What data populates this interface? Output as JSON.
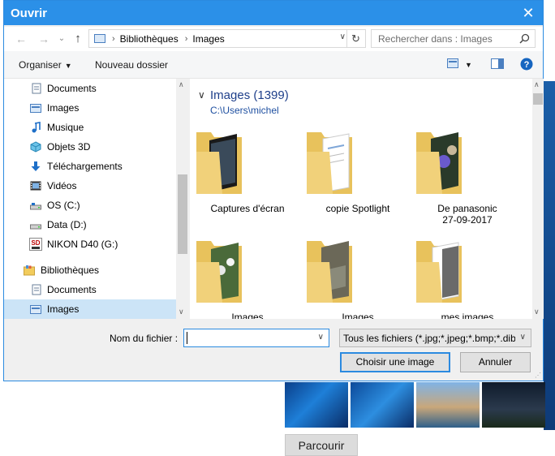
{
  "dialog": {
    "title": "Ouvrir",
    "close": "✕"
  },
  "address": {
    "crumbs": [
      "Bibliothèques",
      "Images"
    ],
    "sep": "›"
  },
  "search": {
    "placeholder": "Rechercher dans : Images"
  },
  "toolbar": {
    "organize": "Organiser",
    "new_folder": "Nouveau dossier"
  },
  "sidebar": {
    "items": [
      {
        "label": "Documents",
        "icon": "documents-icon"
      },
      {
        "label": "Images",
        "icon": "pictures-icon"
      },
      {
        "label": "Musique",
        "icon": "music-icon"
      },
      {
        "label": "Objets 3D",
        "icon": "objects3d-icon"
      },
      {
        "label": "Téléchargements",
        "icon": "download-icon"
      },
      {
        "label": "Vidéos",
        "icon": "videos-icon"
      },
      {
        "label": "OS (C:)",
        "icon": "drive-icon"
      },
      {
        "label": "Data (D:)",
        "icon": "drive-icon"
      },
      {
        "label": "NIKON D40 (G:)",
        "icon": "sdcard-icon"
      },
      {
        "label": "Bibliothèques",
        "icon": "library-icon"
      },
      {
        "label": "Documents",
        "icon": "documents-icon"
      },
      {
        "label": "Images",
        "icon": "pictures-icon"
      }
    ],
    "sd_text": "SD"
  },
  "content": {
    "group_title": "Images (1399)",
    "group_path": "C:\\Users\\michel",
    "tiles": [
      {
        "label": "Captures d'écran"
      },
      {
        "label": "copie Spotlight"
      },
      {
        "label": "De panasonic\n27-09-2017"
      },
      {
        "label": "Images"
      },
      {
        "label": "Images"
      },
      {
        "label": "mes images"
      }
    ]
  },
  "bottom": {
    "filename_label": "Nom du fichier :",
    "filename_value": "",
    "filter": "Tous les fichiers (*.jpg;*.jpeg;*.bmp;*.dib",
    "open_button": "Choisir une image",
    "cancel_button": "Annuler"
  },
  "background": {
    "browse_button": "Parcourir"
  }
}
